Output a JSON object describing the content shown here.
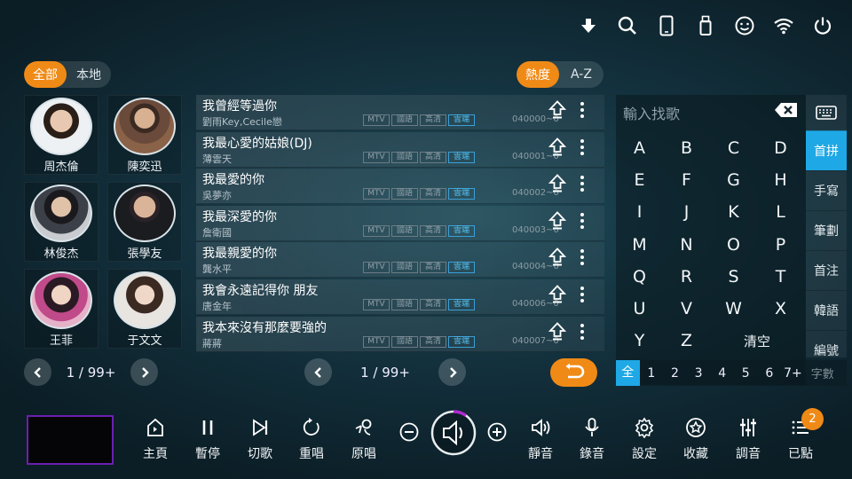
{
  "top_icons": [
    "download-icon",
    "search-icon",
    "phone-icon",
    "usb-icon",
    "smiley-icon",
    "wifi-icon",
    "power-icon"
  ],
  "filter": {
    "all": "全部",
    "local": "本地"
  },
  "sort": {
    "hot": "熱度",
    "az": "A-Z"
  },
  "artists": [
    {
      "name": "周杰倫"
    },
    {
      "name": "陳奕迅"
    },
    {
      "name": "林俊杰"
    },
    {
      "name": "張學友"
    },
    {
      "name": "王菲"
    },
    {
      "name": "于文文"
    }
  ],
  "songs": [
    {
      "title": "我曾經等過你",
      "singer": "劉雨Key,Cecile戀",
      "tags": [
        "MTV",
        "國語",
        "高清",
        "雲端"
      ],
      "code": "040000~0"
    },
    {
      "title": "我最心愛的姑娘(DJ)",
      "singer": "薄雲天",
      "tags": [
        "MTV",
        "國語",
        "高清",
        "雲端"
      ],
      "code": "040001~0"
    },
    {
      "title": "我最愛的你",
      "singer": "吳夢亦",
      "tags": [
        "MTV",
        "國語",
        "高清",
        "雲端"
      ],
      "code": "040002~0"
    },
    {
      "title": "我最深愛的你",
      "singer": "詹衛國",
      "tags": [
        "MTV",
        "國語",
        "高清",
        "雲端"
      ],
      "code": "040003~0"
    },
    {
      "title": "我最親愛的你",
      "singer": "龔水平",
      "tags": [
        "MTV",
        "國語",
        "高清",
        "雲端"
      ],
      "code": "040004~0"
    },
    {
      "title": "我會永遠記得你 朋友",
      "singer": "唐金年",
      "tags": [
        "MTV",
        "國語",
        "高清",
        "雲端"
      ],
      "code": "040006~0"
    },
    {
      "title": "我本來沒有那麼要強的",
      "singer": "蔣蔣",
      "tags": [
        "MTV",
        "國語",
        "高清",
        "雲端"
      ],
      "code": "040007~0"
    }
  ],
  "artist_pager": {
    "page": "1 / 99+"
  },
  "song_pager": {
    "page": "1 / 99+"
  },
  "keyboard": {
    "placeholder": "輸入找歌",
    "keys": [
      "A",
      "B",
      "C",
      "D",
      "E",
      "F",
      "G",
      "H",
      "I",
      "J",
      "K",
      "L",
      "M",
      "N",
      "O",
      "P",
      "Q",
      "R",
      "S",
      "T",
      "U",
      "V",
      "W",
      "X",
      "Y",
      "Z"
    ],
    "clear": "清空"
  },
  "input_modes": [
    {
      "label": "首拼",
      "active": true
    },
    {
      "label": "手寫"
    },
    {
      "label": "筆劃"
    },
    {
      "label": "首注"
    },
    {
      "label": "韓語"
    },
    {
      "label": "編號"
    }
  ],
  "word_count": {
    "items": [
      "全",
      "1",
      "2",
      "3",
      "4",
      "5",
      "6",
      "7+"
    ],
    "label": "字數"
  },
  "toolbar": [
    {
      "label": "主頁",
      "icon": "home-icon"
    },
    {
      "label": "暫停",
      "icon": "pause-icon"
    },
    {
      "label": "切歌",
      "icon": "skip-icon"
    },
    {
      "label": "重唱",
      "icon": "replay-icon"
    },
    {
      "label": "原唱",
      "icon": "vocal-icon"
    },
    {
      "label": "靜音",
      "icon": "mute-icon"
    },
    {
      "label": "錄音",
      "icon": "mic-icon"
    },
    {
      "label": "設定",
      "icon": "gear-icon"
    },
    {
      "label": "收藏",
      "icon": "star-icon"
    },
    {
      "label": "調音",
      "icon": "tune-icon"
    },
    {
      "label": "已點",
      "icon": "list-icon"
    }
  ],
  "queue_count": "2",
  "accent": "#f08a16",
  "highlight": "#1ea8e6"
}
